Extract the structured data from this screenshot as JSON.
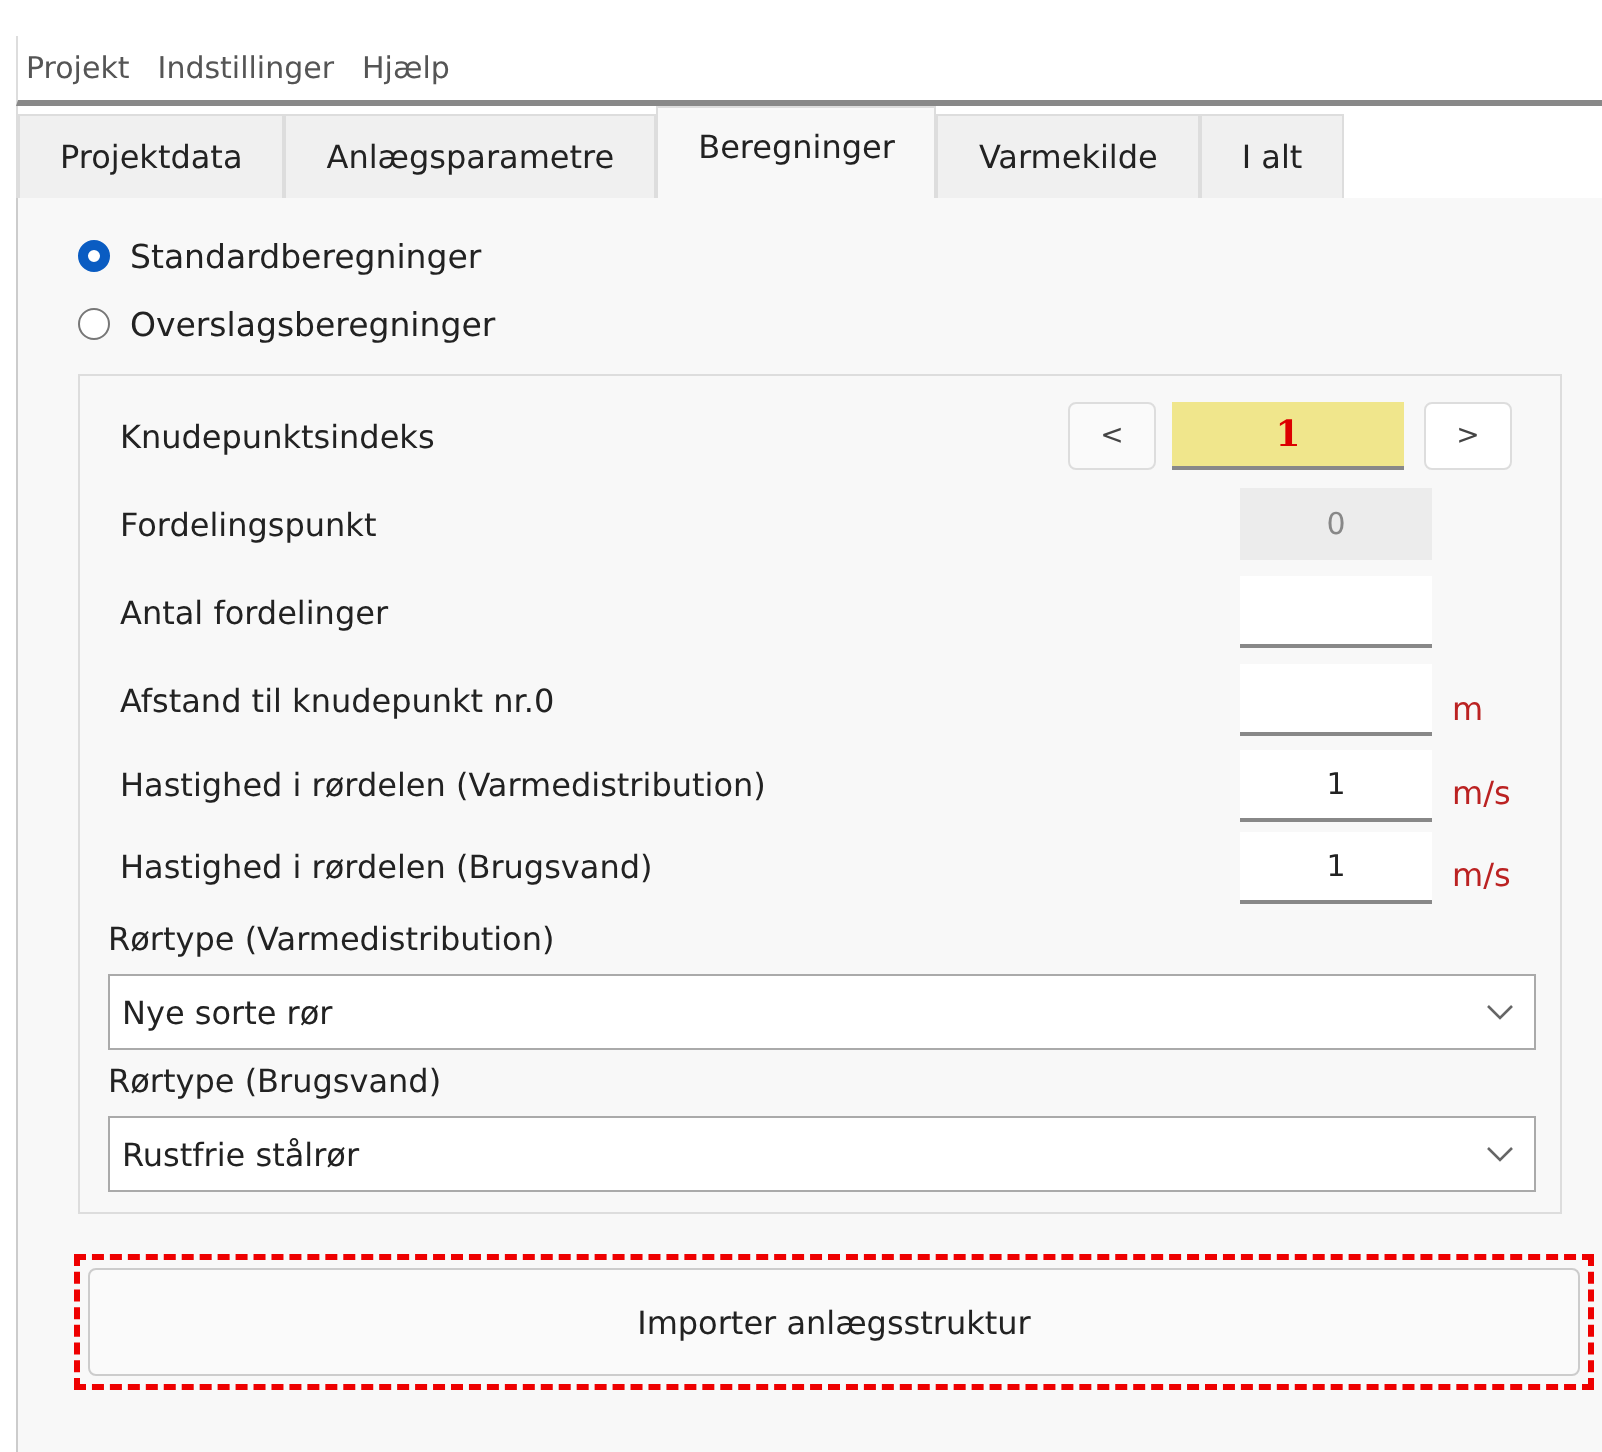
{
  "menu": [
    "Projekt",
    "Indstillinger",
    "Hjælp"
  ],
  "tabs": [
    {
      "label": "Projektdata",
      "selected": false
    },
    {
      "label": "Anlægsparametre",
      "selected": false
    },
    {
      "label": "Beregninger",
      "selected": true
    },
    {
      "label": "Varmekilde",
      "selected": false
    },
    {
      "label": "I alt",
      "selected": false
    }
  ],
  "calc_mode": [
    {
      "label": "Standardberegninger",
      "selected": true
    },
    {
      "label": "Overslagsberegninger",
      "selected": false
    }
  ],
  "fields": [
    {
      "kind": "stepper",
      "label": "Knudepunktsindeks",
      "value": "1",
      "prev": "<",
      "next": ">"
    },
    {
      "kind": "readonly",
      "label": "Fordelingspunkt",
      "value": "0"
    },
    {
      "kind": "input",
      "label": "Antal fordelinger"
    },
    {
      "kind": "input",
      "label": "Afstand til knudepunkt nr.0",
      "unit": "m"
    },
    {
      "kind": "input",
      "label": "Hastighed i rørdelen (Varmedistribution)",
      "value": "1",
      "unit": "m/s"
    },
    {
      "kind": "input",
      "label": "Hastighed i rørdelen (Brugsvand)",
      "value": "1",
      "unit": "m/s"
    }
  ],
  "selects": [
    {
      "label": "Rørtype (Varmedistribution)",
      "value": "Nye sorte rør"
    },
    {
      "label": "Rørtype (Brugsvand)",
      "value": "Rustfrie stålrør"
    }
  ],
  "import_button": {
    "label": "Importer anlægsstruktur",
    "highlighted": true
  }
}
